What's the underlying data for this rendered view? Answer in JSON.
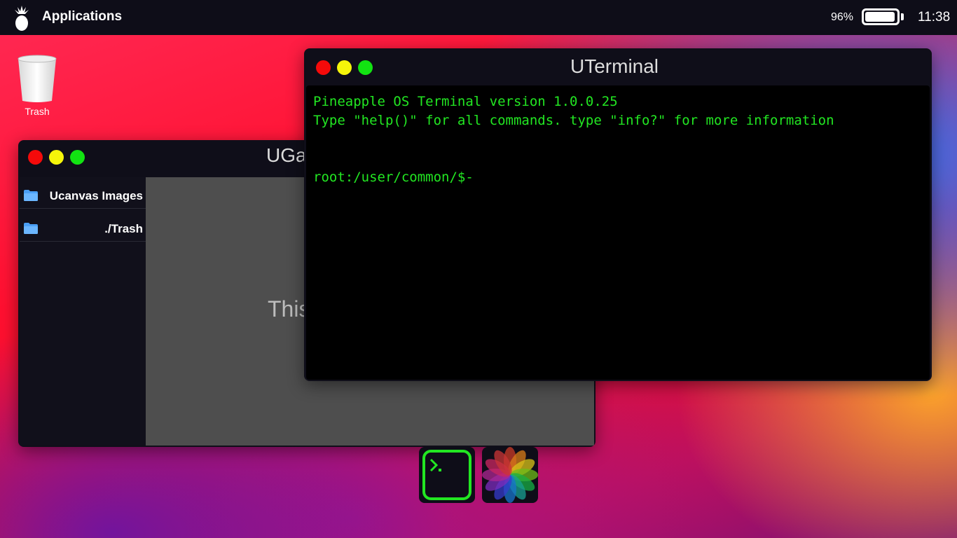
{
  "topbar": {
    "apps_label": "Applications",
    "battery_percent": "96%",
    "battery_level": 0.96,
    "time": "11:38"
  },
  "desktop": {
    "trash_label": "Trash"
  },
  "gallery_window": {
    "title": "UGa",
    "folders": [
      {
        "label": "Ucanvas Images"
      },
      {
        "label": "./Trash"
      }
    ],
    "content_text": "This"
  },
  "terminal_window": {
    "title": "UTerminal",
    "lines": [
      "Pineapple OS Terminal version 1.0.0.25",
      "Type \"help()\" for all commands. type \"info?\" for more information",
      "",
      "root:/user/common/$-"
    ]
  },
  "dock": {
    "items": [
      {
        "icon": "terminal-icon"
      },
      {
        "icon": "photos-icon"
      }
    ]
  },
  "colors": {
    "terminal_text": "#22e622",
    "close": "#f50a0a",
    "minimize": "#f5f50a",
    "maximize": "#12e312"
  }
}
